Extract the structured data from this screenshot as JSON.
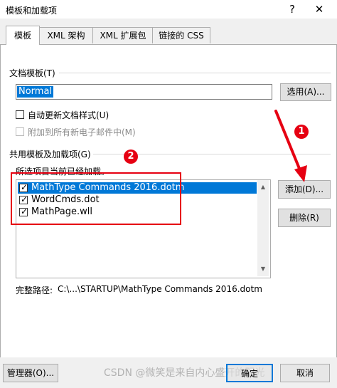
{
  "window": {
    "title": "模板和加载项",
    "help": "?",
    "close": "✕"
  },
  "tabs": [
    {
      "label": "模板"
    },
    {
      "label": "XML 架构"
    },
    {
      "label": "XML 扩展包"
    },
    {
      "label": "链接的 CSS"
    }
  ],
  "document_template": {
    "group_label": "文档模板(T)",
    "value": "Normal",
    "choose_button": "选用(A)...",
    "auto_update": {
      "label": "自动更新文档样式(U)",
      "checked": false
    },
    "attach_new_mail": {
      "label": "附加到所有新电子邮件中(M)",
      "checked": false,
      "disabled": true
    }
  },
  "global_templates": {
    "group_label": "共用模板及加载项(G)",
    "hint": "所选项目当前已经加载。",
    "items": [
      {
        "label": "MathType Commands 2016.dotm",
        "checked": true,
        "selected": true
      },
      {
        "label": "WordCmds.dot",
        "checked": true,
        "selected": false
      },
      {
        "label": "MathPage.wll",
        "checked": true,
        "selected": false
      }
    ],
    "add_button": "添加(D)...",
    "remove_button": "删除(R)",
    "fullpath_label": "完整路径:",
    "fullpath_value": "C:\\...\\STARTUP\\MathType Commands 2016.dotm"
  },
  "annotations": {
    "badge1": "1",
    "badge2": "2"
  },
  "footer": {
    "organizer_button": "管理器(O)...",
    "ok_button": "确定",
    "cancel_button": "取消",
    "watermark": "CSDN @微笑是来自内心盛开的阳光"
  },
  "colors": {
    "accent": "#0078d7",
    "annotation_red": "#e60012"
  }
}
